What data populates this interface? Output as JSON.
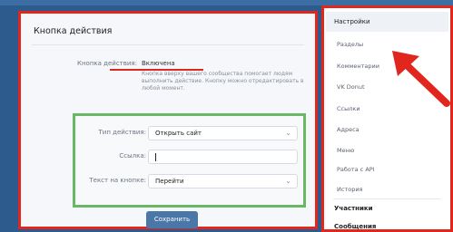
{
  "card": {
    "title": "Кнопка действия",
    "action_label": "Кнопка действия:",
    "action_value": "Включена",
    "description": "Кнопка вверху вашего сообщества помогает людям выполнить действие. Кнопку можно отредактировать в любой момент."
  },
  "form": {
    "type_label": "Тип действия:",
    "type_value": "Открыть сайт",
    "link_label": "Ссылка:",
    "link_value": "",
    "button_text_label": "Текст на кнопке:",
    "button_text_value": "Перейти"
  },
  "save_button": "Сохранить",
  "sidebar": {
    "settings": "Настройки",
    "items": [
      "Разделы",
      "Комментарии",
      "VK Donut",
      "Ссылки",
      "Адреса",
      "Меню",
      "Работа с API",
      "История"
    ],
    "participants": "Участники",
    "messages": "Сообщения"
  },
  "colors": {
    "highlight_red": "#e0261d",
    "highlight_green": "#69b865",
    "primary_button": "#4a76a8"
  },
  "icons": {
    "dropdown": "chevron-down-icon",
    "annotation": "red-arrow-icon"
  }
}
